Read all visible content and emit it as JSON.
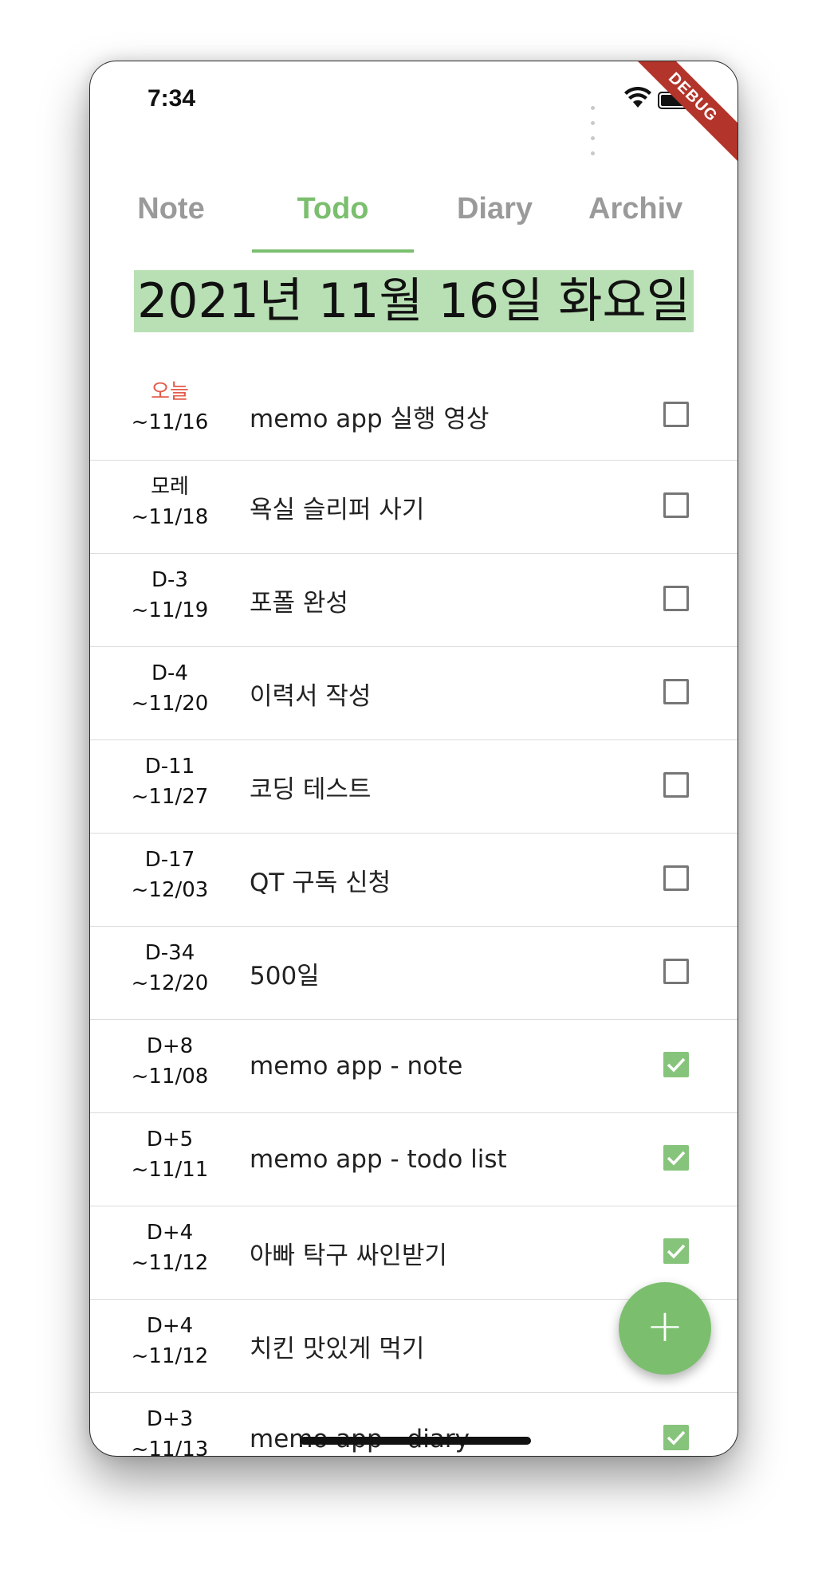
{
  "status_bar": {
    "time": "7:34",
    "debug": "DEBUG"
  },
  "tabs": [
    {
      "label": "Note"
    },
    {
      "label": "Todo",
      "active": true
    },
    {
      "label": "Diary"
    },
    {
      "label": "Archiv"
    }
  ],
  "date_header": "2021년 11월 16일 화요일",
  "todos": [
    {
      "dday": "오늘",
      "due": "~11/16",
      "title": "memo app 실행 영상",
      "checked": false
    },
    {
      "dday": "모레",
      "due": "~11/18",
      "title": "욕실 슬리퍼 사기",
      "checked": false
    },
    {
      "dday": "D-3",
      "due": "~11/19",
      "title": "포폴 완성",
      "checked": false
    },
    {
      "dday": "D-4",
      "due": "~11/20",
      "title": "이력서 작성",
      "checked": false
    },
    {
      "dday": "D-11",
      "due": "~11/27",
      "title": "코딩 테스트",
      "checked": false
    },
    {
      "dday": "D-17",
      "due": "~12/03",
      "title": "QT 구독 신청",
      "checked": false
    },
    {
      "dday": "D-34",
      "due": "~12/20",
      "title": "500일",
      "checked": false
    },
    {
      "dday": "D+8",
      "due": "~11/08",
      "title": "memo app - note",
      "checked": true
    },
    {
      "dday": "D+5",
      "due": "~11/11",
      "title": "memo app - todo list",
      "checked": true
    },
    {
      "dday": "D+4",
      "due": "~11/12",
      "title": "아빠 탁구 싸인받기",
      "checked": true
    },
    {
      "dday": "D+4",
      "due": "~11/12",
      "title": "치킨 맛있게 먹기",
      "checked": true
    },
    {
      "dday": "D+3",
      "due": "~11/13",
      "title": "memo app - diary",
      "checked": true
    }
  ],
  "fab": {
    "icon": "plus-icon",
    "label": "+"
  },
  "colors": {
    "accent": "#7bbf6e",
    "today": "#e45b4b",
    "date_highlight": "#b9e0b4"
  }
}
